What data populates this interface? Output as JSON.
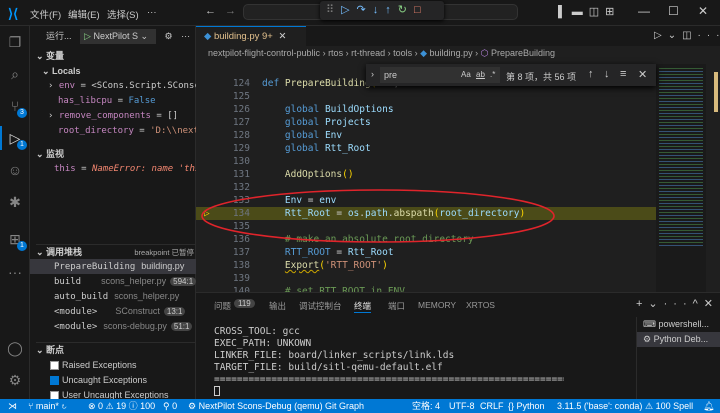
{
  "menu": [
    "文件(F)",
    "编辑(E)",
    "选择(S)",
    "···"
  ],
  "debug_toolbar": [
    "continue",
    "step-over",
    "step-into",
    "step-out",
    "restart",
    "stop"
  ],
  "sidebar": {
    "run_label": "运行...",
    "config": "NextPilot S",
    "variables_title": "变量",
    "locals_title": "Locals",
    "locals": [
      {
        "name": "env",
        "value": "<SCons.Script.SConscr…",
        "expandable": true
      },
      {
        "name": "has_libcpu",
        "value": "False",
        "expandable": false
      },
      {
        "name": "remove_components",
        "value": "[]",
        "expandable": true
      },
      {
        "name": "root_directory",
        "value": "'D:\\\\nextp…",
        "expandable": false
      }
    ],
    "watch_title": "监视",
    "watch": {
      "name": "this",
      "value": "NameError: name 'this…"
    },
    "callstack_title": "调用堆栈",
    "callstack_status": "breakpoint 已暂停",
    "callstack": [
      {
        "fn": "PrepareBuilding",
        "file": "building.py",
        "pos": ""
      },
      {
        "fn": "build",
        "file": "scons_helper.py",
        "pos": "594:1"
      },
      {
        "fn": "auto_build",
        "file": "scons_helper.py",
        "pos": ""
      },
      {
        "fn": "<module>",
        "file": "SConstruct",
        "pos": "13:1"
      },
      {
        "fn": "<module>",
        "file": "scons-debug.py",
        "pos": "51:1"
      }
    ],
    "breakpoints_title": "断点",
    "breakpoints": [
      {
        "label": "Raised Exceptions",
        "checked": false
      },
      {
        "label": "Uncaught Exceptions",
        "checked": true
      },
      {
        "label": "User Uncaught Exceptions",
        "checked": false
      }
    ]
  },
  "editor": {
    "tab": "building.py",
    "tab_badge": "9+",
    "breadcrumb": [
      "nextpilot-flight-control-public",
      "rtos",
      "rt-thread",
      "tools",
      "building.py",
      "PrepareBuilding"
    ],
    "find": {
      "query": "pre",
      "result": "第 8 项，共 56 项",
      "opts": [
        "Aa",
        "ab",
        ".*"
      ]
    },
    "lines": [
      {
        "n": "124",
        "html": "<span class='kw'>def</span> <span class='fn'>PrepareBuilding</span><span class='pn'>(</span><span class='id'>env</span>, ..."
      },
      {
        "n": "125",
        "html": ""
      },
      {
        "n": "126",
        "html": "    <span class='kw'>global</span> <span class='id'>BuildOptions</span>"
      },
      {
        "n": "127",
        "html": "    <span class='kw'>global</span> <span class='id'>Projects</span>"
      },
      {
        "n": "128",
        "html": "    <span class='kw'>global</span> <span class='id'>Env</span>"
      },
      {
        "n": "129",
        "html": "    <span class='kw'>global</span> <span class='id'>Rtt_Root</span>"
      },
      {
        "n": "130",
        "html": ""
      },
      {
        "n": "131",
        "html": "    <span class='fn'>AddOptions</span><span class='pn'>()</span>"
      },
      {
        "n": "132",
        "html": ""
      },
      {
        "n": "133",
        "html": "    <span class='id'>Env</span> = <span class='id'>env</span>"
      },
      {
        "n": "134",
        "html": "    <span class='id'>Rtt_Root</span> = <span class='id'>os</span>.<span class='id'>path</span>.<span class='fn'>abspath</span><span class='pn'>(</span><span class='id'>root_directory</span><span class='pn'>)</span>"
      },
      {
        "n": "135",
        "html": ""
      },
      {
        "n": "136",
        "html": "    <span class='cm'># make an absolute root directory</span>"
      },
      {
        "n": "137",
        "html": "    <span class='kw'>RTT_ROOT</span> = <span class='id'>Rtt_Root</span>"
      },
      {
        "n": "138",
        "html": "    <span class='fn' style='text-decoration:underline wavy #cca700'>Export</span><span class='pn'>(</span><span class='st'>'RTT_ROOT'</span><span class='pn'>)</span>"
      },
      {
        "n": "139",
        "html": ""
      },
      {
        "n": "140",
        "html": "    <span class='cm'># set RTT_ROOT in ENV</span>"
      }
    ],
    "current_line": "134"
  },
  "panel": {
    "tabs": [
      "问题",
      "输出",
      "调试控制台",
      "终端",
      "端口",
      "MEMORY",
      "XRTOS"
    ],
    "problems_count": "119",
    "active_tab": "终端",
    "terminal": [
      "CROSS_TOOL: gcc",
      "EXEC_PATH: UNKOWN",
      "LINKER_FILE: board/linker_scripts/link.lds",
      "TARGET_FILE: build/sitl-qemu-default.elf",
      "================================================================"
    ],
    "terminals": [
      "powershell...",
      "Python Deb..."
    ]
  },
  "status": {
    "branch": "main*",
    "errors": "0",
    "warnings": "19",
    "info": "100",
    "ports": "0",
    "debug": "NextPilot Scons-Debug (qemu)",
    "git_graph": "Git Graph",
    "spaces": "空格: 4",
    "encoding": "UTF-8",
    "eol": "CRLF",
    "lang": "Python",
    "interpreter": "3.11.5 ('base': conda)",
    "spell": "100 Spell"
  },
  "colors": {
    "accent": "#0078d4",
    "highlight_line": "#4b4b18",
    "annotation": "#e0242b"
  }
}
